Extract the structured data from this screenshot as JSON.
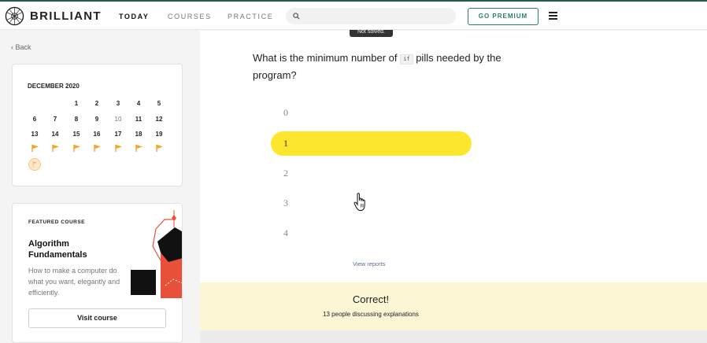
{
  "header": {
    "brand": "BRILLIANT",
    "nav": [
      {
        "label": "TODAY",
        "active": true
      },
      {
        "label": "COURSES",
        "active": false
      },
      {
        "label": "PRACTICE",
        "active": false
      }
    ],
    "search_placeholder": "",
    "premium_label": "GO PREMIUM",
    "accent_color": "#2a7f68"
  },
  "sidebar": {
    "back_label": "Back",
    "calendar": {
      "month": "DECEMBER 2020",
      "week1": [
        "1",
        "2",
        "3",
        "4",
        "5"
      ],
      "week2": [
        "6",
        "7",
        "8",
        "9",
        "10",
        "11",
        "12"
      ],
      "week3": [
        "13",
        "14",
        "15",
        "16",
        "17",
        "18",
        "19"
      ]
    },
    "featured": {
      "label": "FEATURED COURSE",
      "title": "Algorithm Fundamentals",
      "description": "How to make a computer do what you want, elegantly and efficiently.",
      "button": "Visit course"
    }
  },
  "main": {
    "tooltip": "Not solved.",
    "question_prefix": "What is the minimum number of",
    "question_code": "if",
    "question_suffix": "pills needed by the program?",
    "options": [
      "0",
      "1",
      "2",
      "3",
      "4"
    ],
    "selected_option": "1",
    "view_reports": "View reports"
  },
  "result": {
    "title": "Correct!",
    "discussion": "13 people discussing explanations",
    "background_color": "#fcf6d5"
  }
}
